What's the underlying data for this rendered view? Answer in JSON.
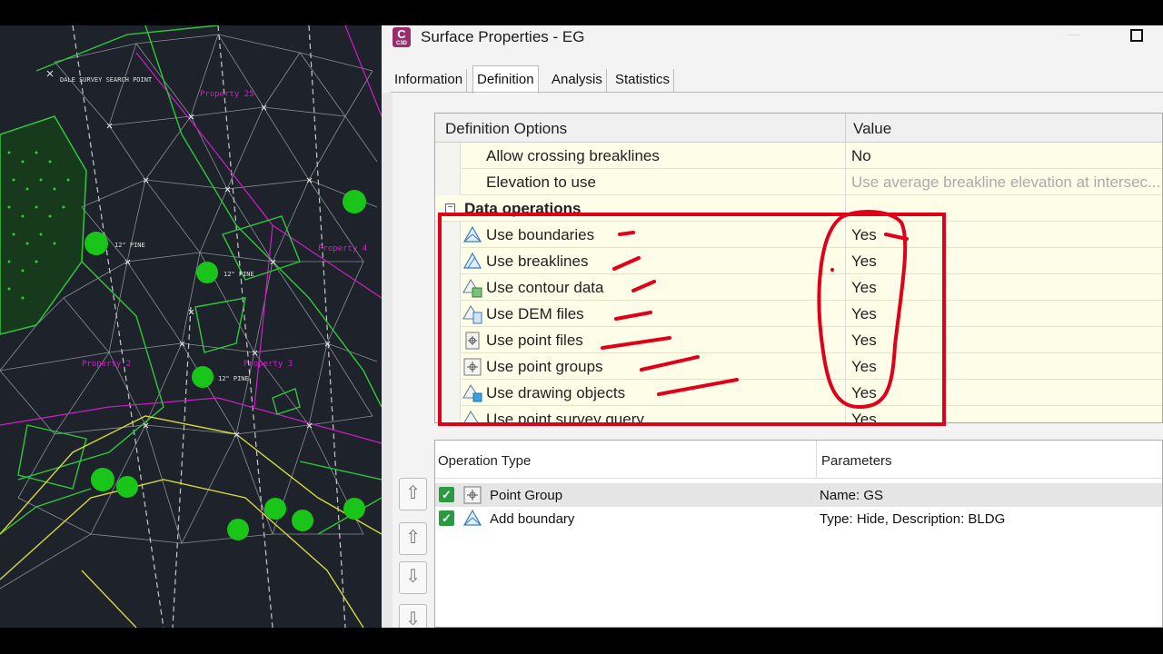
{
  "window": {
    "title": "Surface Properties - EG",
    "app_icon_letter": "C",
    "app_icon_sub": "C3D"
  },
  "tabs": [
    {
      "label": "Information",
      "active": false
    },
    {
      "label": "Definition",
      "active": true
    },
    {
      "label": "Analysis",
      "active": false
    },
    {
      "label": "Statistics",
      "active": false
    }
  ],
  "definition_grid": {
    "col_options": "Definition Options",
    "col_value": "Value",
    "rows": [
      {
        "name": "Allow crossing breaklines",
        "value": "No"
      },
      {
        "name": "Elevation to use",
        "value": "Use average breakline elevation at intersec..."
      }
    ],
    "section": {
      "label": "Data operations",
      "collapse_symbol": "−"
    },
    "operation_rows": [
      {
        "name": "Use boundaries",
        "value": "Yes",
        "icon": "boundary-icon"
      },
      {
        "name": "Use breaklines",
        "value": "Yes",
        "icon": "breakline-icon"
      },
      {
        "name": "Use contour data",
        "value": "Yes",
        "icon": "contour-icon"
      },
      {
        "name": "Use DEM files",
        "value": "Yes",
        "icon": "dem-file-icon"
      },
      {
        "name": "Use point files",
        "value": "Yes",
        "icon": "point-file-icon"
      },
      {
        "name": "Use point groups",
        "value": "Yes",
        "icon": "point-group-icon"
      },
      {
        "name": "Use drawing objects",
        "value": "Yes",
        "icon": "drawing-object-icon"
      },
      {
        "name": "Use point survey query",
        "value": "Yes",
        "icon": "survey-query-icon"
      }
    ]
  },
  "operations_table": {
    "col_type": "Operation Type",
    "col_params": "Parameters",
    "rows": [
      {
        "type": "Point Group",
        "params": "Name: GS",
        "checked": "✓",
        "icon": "point-group-icon"
      },
      {
        "type": "Add boundary",
        "params": "Type: Hide,  Description: BLDG",
        "checked": "✓",
        "icon": "boundary-icon"
      }
    ]
  },
  "move_buttons": [
    {
      "symbol": "⇧",
      "icon": "move-top-icon"
    },
    {
      "symbol": "⇧",
      "icon": "move-up-icon"
    },
    {
      "symbol": "⇩",
      "icon": "move-down-icon"
    },
    {
      "symbol": "⇩",
      "icon": "move-bottom-icon"
    }
  ],
  "cad_labels": [
    "Property 25",
    "Property 4",
    "Property 2",
    "Property 3",
    "12\" PINE",
    "12\" PINE",
    "12\" PINE",
    "DALE SURVEY SEARCH POINT"
  ],
  "colors": {
    "annotation_red": "#e0001a",
    "cad_background": "#1e222a",
    "grid_row": "#fefde8",
    "check_green": "#2a9a41"
  }
}
